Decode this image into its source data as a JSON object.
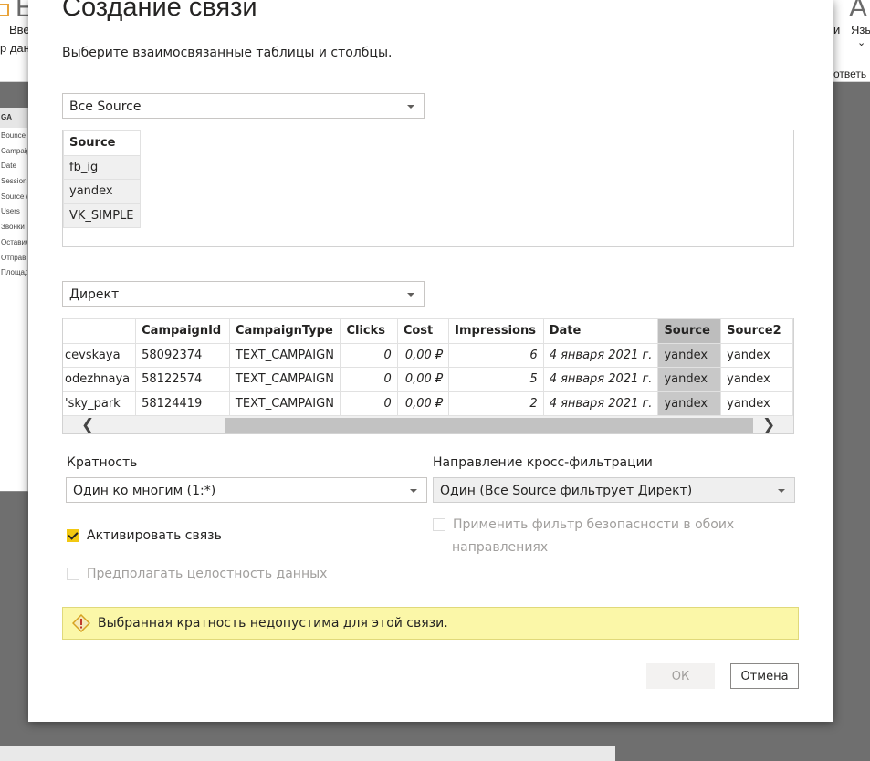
{
  "background_app": {
    "ribbon_texts": [
      "Вве",
      "р дан",
      "и",
      "Язы",
      "ответь",
      "Е",
      "А"
    ],
    "field_panel": {
      "header": "GA",
      "fields": [
        "Bounce",
        "Campaig",
        "Date",
        "Sessions",
        "Source /",
        "Users",
        "Звонки",
        "Оставил",
        "Отправ",
        "Площад"
      ]
    }
  },
  "dialog": {
    "title": "Создание связи",
    "subtitle": "Выберите взаимосвязанные таблицы и столбцы.",
    "table1": {
      "selected": "Все Source",
      "columns": [
        "Source"
      ],
      "rows": [
        [
          "fb_ig"
        ],
        [
          "yandex"
        ],
        [
          "VK_SIMPLE"
        ]
      ]
    },
    "table2": {
      "selected": "Директ",
      "columns": [
        "",
        "CampaignId",
        "CampaignType",
        "Clicks",
        "Cost",
        "Impressions",
        "Date",
        "Source",
        "Source2"
      ],
      "rows": [
        [
          "cevskaya",
          "58092374",
          "TEXT_CAMPAIGN",
          "0",
          "0,00 ₽",
          "6",
          "4 января 2021 г.",
          "yandex",
          "yandex"
        ],
        [
          "odezhnaya",
          "58122574",
          "TEXT_CAMPAIGN",
          "0",
          "0,00 ₽",
          "5",
          "4 января 2021 г.",
          "yandex",
          "yandex"
        ],
        [
          "'sky_park",
          "58124419",
          "TEXT_CAMPAIGN",
          "0",
          "0,00 ₽",
          "2",
          "4 января 2021 г.",
          "yandex",
          "yandex"
        ]
      ],
      "selected_column": "Source",
      "scroll_left": "❮",
      "scroll_right": "❯"
    },
    "cardinality": {
      "label": "Кратность",
      "value": "Один ко многим (1:*)"
    },
    "cross_filter": {
      "label": "Направление кросс-фильтрации",
      "value": "Один (Все Source фильтрует Директ)"
    },
    "activate": {
      "label": "Активировать связь",
      "checked": true
    },
    "referential_integrity": {
      "label": "Предполагать целостность данных",
      "checked": false
    },
    "security_filter": {
      "label_line1": "Применить фильтр безопасности в обоих",
      "label_line2": "направлениях",
      "checked": false
    },
    "warning": {
      "text": "Выбранная кратность недопустима для этой связи.",
      "icon": "warning-icon"
    },
    "buttons": {
      "ok": "ОК",
      "cancel": "Отмена"
    },
    "colors": {
      "accent": "#f2c811",
      "warning_bg": "#fbf7a8",
      "selected_column": "#c8c8c8"
    }
  }
}
